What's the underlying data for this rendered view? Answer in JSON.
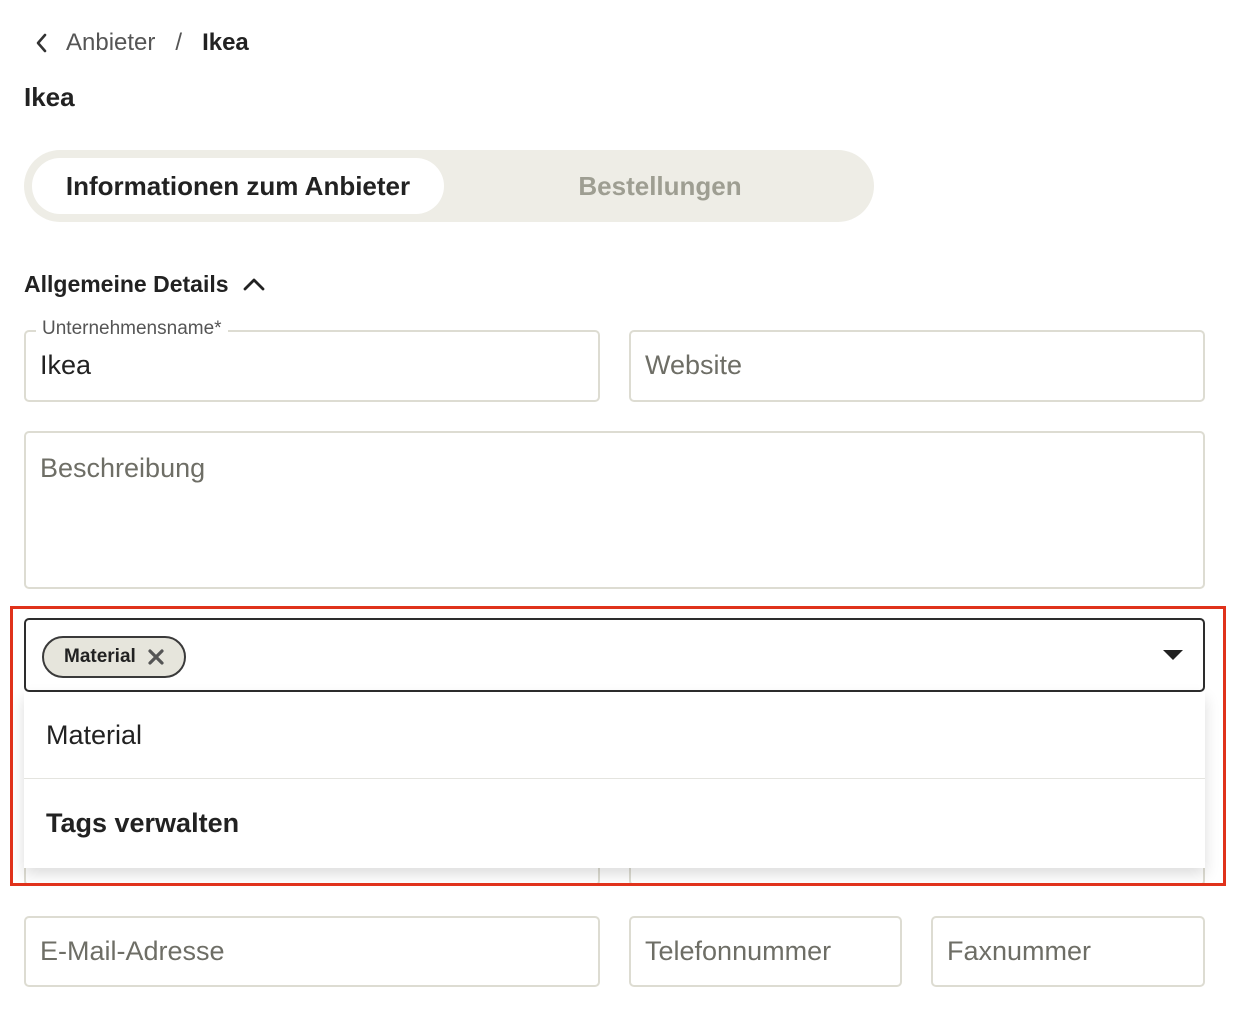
{
  "breadcrumb": {
    "parent": "Anbieter",
    "separator": "/",
    "current": "Ikea"
  },
  "page_title": "Ikea",
  "tabs": [
    {
      "label": "Informationen zum Anbieter",
      "active": true
    },
    {
      "label": "Bestellungen",
      "active": false
    }
  ],
  "section": {
    "title": "Allgemeine Details",
    "expanded": true
  },
  "fields": {
    "company_name": {
      "label": "Unternehmensname*",
      "value": "Ikea"
    },
    "website": {
      "placeholder": "Website"
    },
    "description": {
      "placeholder": "Beschreibung"
    },
    "email": {
      "placeholder": "E-Mail-Adresse"
    },
    "phone": {
      "placeholder": "Telefonnummer"
    },
    "fax": {
      "placeholder": "Faxnummer"
    }
  },
  "tags": {
    "selected": [
      "Material"
    ],
    "options": [
      "Material"
    ],
    "manage_label": "Tags verwalten"
  },
  "colors": {
    "highlight": "#e0321b",
    "tab_track": "#eeede6",
    "chip_bg": "#e6e5dc",
    "inactive_tab_text": "#9e9e92"
  }
}
